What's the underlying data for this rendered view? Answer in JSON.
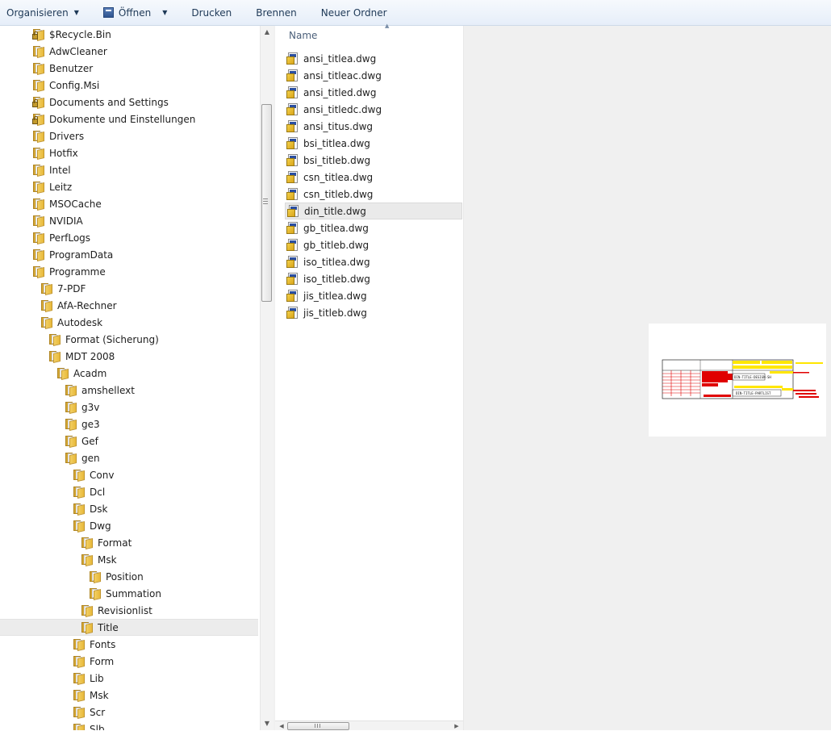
{
  "toolbar": {
    "organize_label": "Organisieren",
    "open_label": "Öffnen",
    "print_label": "Drucken",
    "burn_label": "Brennen",
    "new_folder_label": "Neuer Ordner"
  },
  "nav": {
    "items": [
      {
        "label": "$Recycle.Bin",
        "locked": true
      },
      {
        "label": "AdwCleaner"
      },
      {
        "label": "Benutzer"
      },
      {
        "label": "Config.Msi"
      },
      {
        "label": "Documents and Settings",
        "locked": true
      },
      {
        "label": "Dokumente und Einstellungen",
        "locked": true
      },
      {
        "label": "Drivers"
      },
      {
        "label": "Hotfix"
      },
      {
        "label": "Intel"
      },
      {
        "label": "Leitz"
      },
      {
        "label": "MSOCache"
      },
      {
        "label": "NVIDIA"
      },
      {
        "label": "PerfLogs"
      },
      {
        "label": "ProgramData"
      },
      {
        "label": "Programme"
      },
      {
        "label": "7-PDF"
      },
      {
        "label": "AfA-Rechner"
      },
      {
        "label": "Autodesk"
      },
      {
        "label": "Format (Sicherung)"
      },
      {
        "label": "MDT 2008"
      },
      {
        "label": "Acadm"
      },
      {
        "label": "amshellext"
      },
      {
        "label": "g3v"
      },
      {
        "label": "ge3"
      },
      {
        "label": "Gef"
      },
      {
        "label": "gen"
      },
      {
        "label": "Conv"
      },
      {
        "label": "Dcl"
      },
      {
        "label": "Dsk"
      },
      {
        "label": "Dwg"
      },
      {
        "label": "Format"
      },
      {
        "label": "Msk"
      },
      {
        "label": "Position"
      },
      {
        "label": "Summation"
      },
      {
        "label": "Revisionlist"
      },
      {
        "label": "Title",
        "selected": true
      },
      {
        "label": "Fonts"
      },
      {
        "label": "Form"
      },
      {
        "label": "Lib"
      },
      {
        "label": "Msk"
      },
      {
        "label": "Scr"
      },
      {
        "label": "Slb"
      }
    ]
  },
  "file_list": {
    "column_name": "Name",
    "files": [
      {
        "label": "ansi_titlea.dwg"
      },
      {
        "label": "ansi_titleac.dwg"
      },
      {
        "label": "ansi_titled.dwg"
      },
      {
        "label": "ansi_titledc.dwg"
      },
      {
        "label": "ansi_titus.dwg"
      },
      {
        "label": "bsi_titlea.dwg"
      },
      {
        "label": "bsi_titleb.dwg"
      },
      {
        "label": "csn_titlea.dwg"
      },
      {
        "label": "csn_titleb.dwg"
      },
      {
        "label": "din_title.dwg",
        "selected": true
      },
      {
        "label": "gb_titlea.dwg"
      },
      {
        "label": "gb_titleb.dwg"
      },
      {
        "label": "iso_titlea.dwg"
      },
      {
        "label": "iso_titleb.dwg"
      },
      {
        "label": "jis_titlea.dwg"
      },
      {
        "label": "jis_titleb.dwg"
      }
    ]
  },
  "preview": {
    "line1": "DIN-TITLE-DESIGN-SH",
    "line2": "DIN-TITLE-PARTLIST"
  },
  "colors": {
    "toolbar_text": "#1e3957",
    "cad_red": "#e00000",
    "cad_yellow": "#ffe600"
  }
}
